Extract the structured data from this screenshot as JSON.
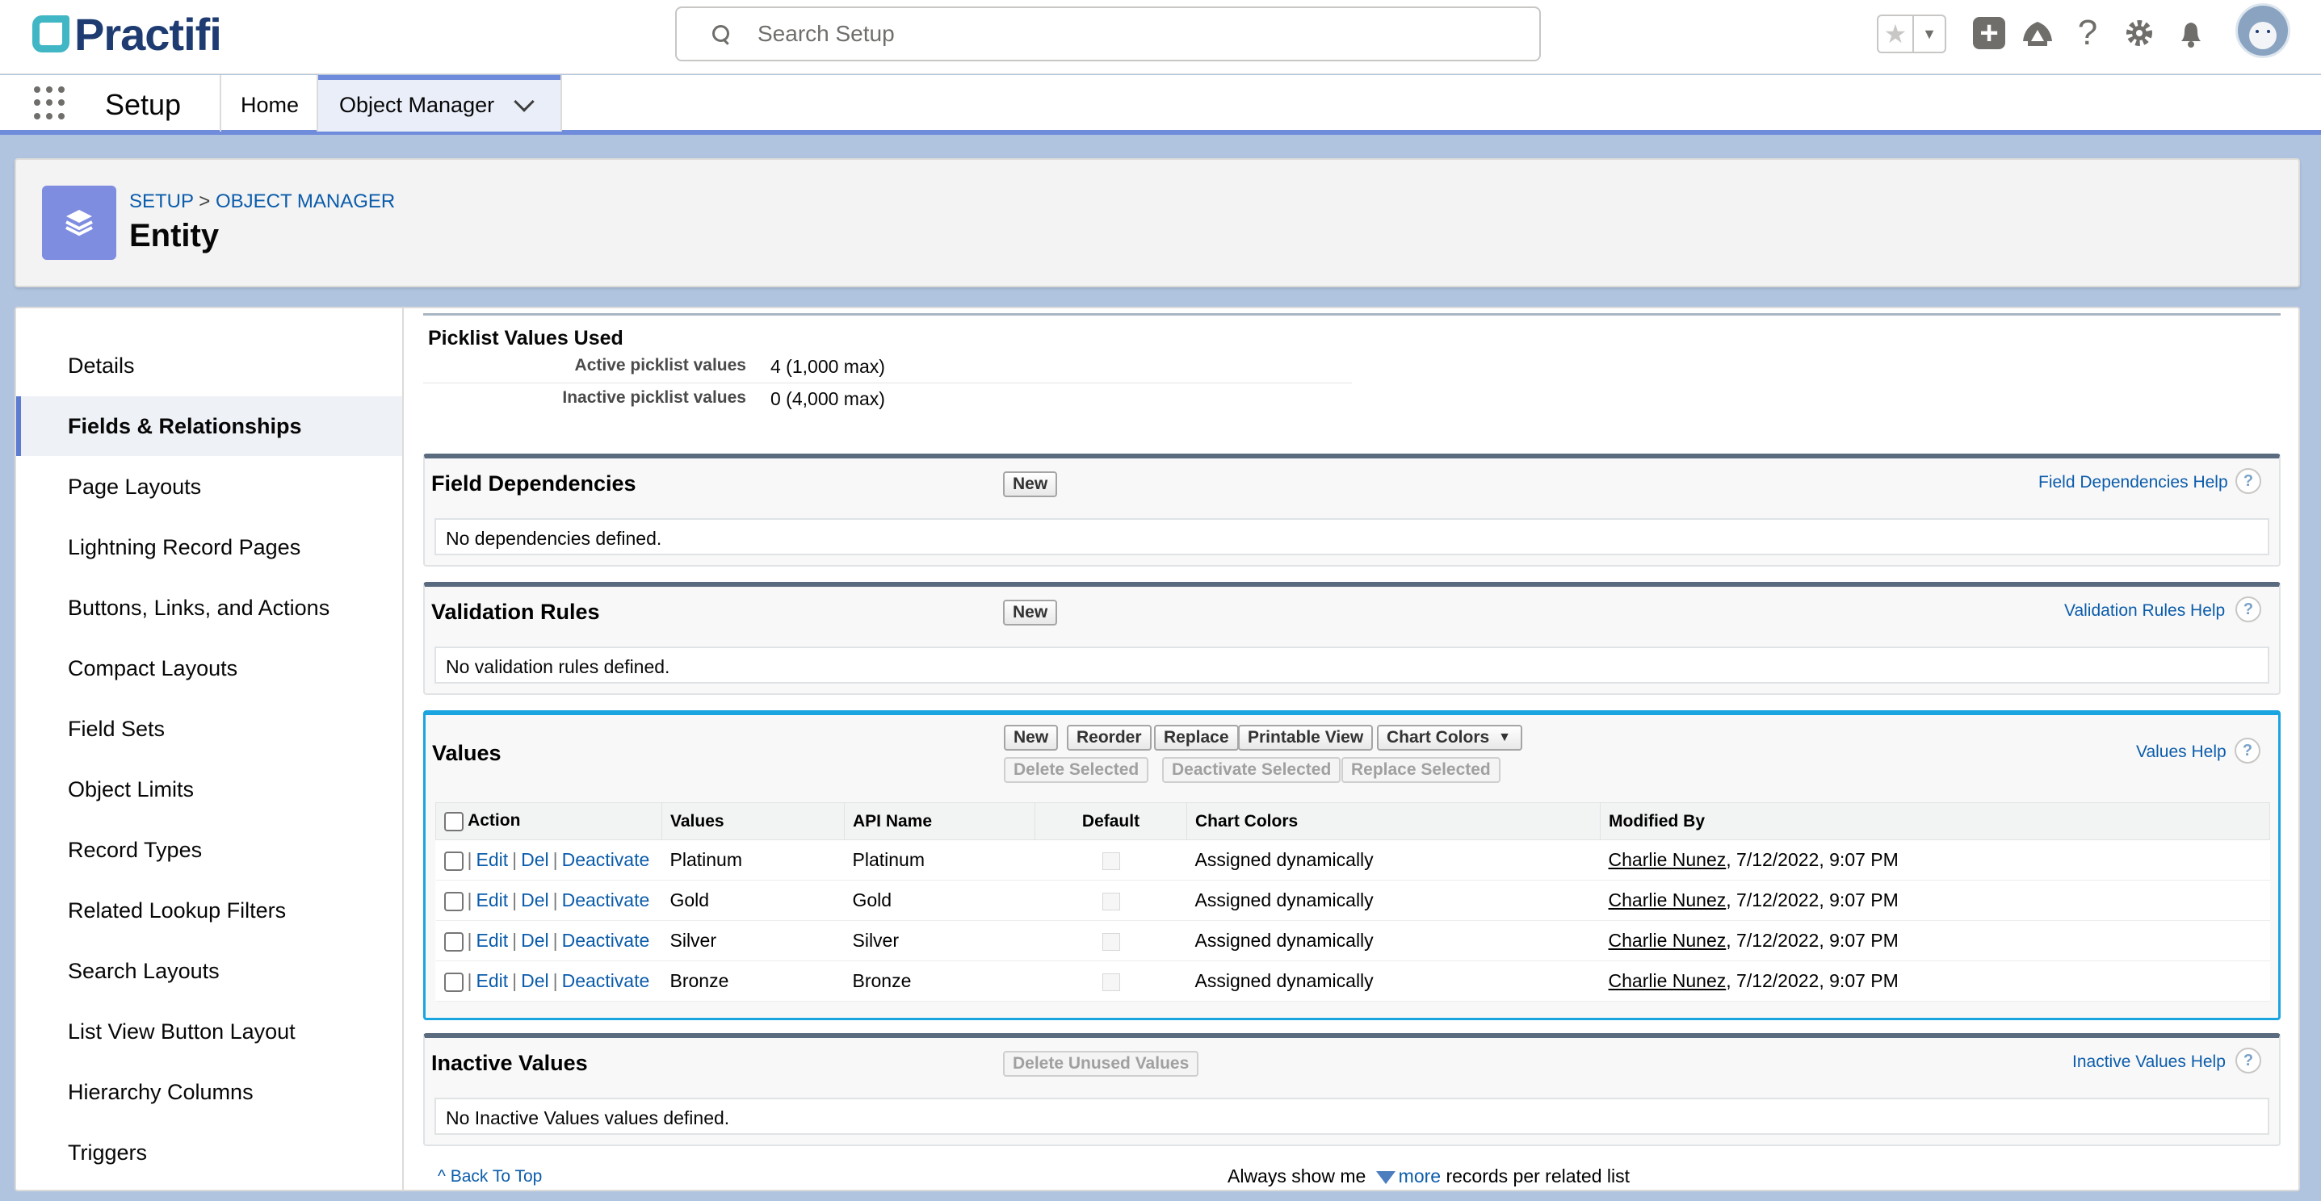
{
  "header": {
    "brand": "Practifi",
    "search_placeholder": "Search Setup"
  },
  "nav": {
    "app_name": "Setup",
    "tabs": [
      {
        "label": "Home"
      },
      {
        "label": "Object Manager"
      }
    ]
  },
  "page": {
    "breadcrumb_root": "SETUP",
    "breadcrumb_sep": ">",
    "breadcrumb_current": "OBJECT MANAGER",
    "title": "Entity"
  },
  "sidebar": {
    "items": [
      {
        "label": "Details"
      },
      {
        "label": "Fields & Relationships"
      },
      {
        "label": "Page Layouts"
      },
      {
        "label": "Lightning Record Pages"
      },
      {
        "label": "Buttons, Links, and Actions"
      },
      {
        "label": "Compact Layouts"
      },
      {
        "label": "Field Sets"
      },
      {
        "label": "Object Limits"
      },
      {
        "label": "Record Types"
      },
      {
        "label": "Related Lookup Filters"
      },
      {
        "label": "Search Layouts"
      },
      {
        "label": "List View Button Layout"
      },
      {
        "label": "Hierarchy Columns"
      },
      {
        "label": "Triggers"
      }
    ]
  },
  "picklist_used": {
    "title": "Picklist Values Used",
    "active_label": "Active picklist values",
    "active_value": "4 (1,000 max)",
    "inactive_label": "Inactive picklist values",
    "inactive_value": "0 (4,000 max)"
  },
  "field_dependencies": {
    "title": "Field Dependencies",
    "new_label": "New",
    "help": "Field Dependencies Help",
    "empty": "No dependencies defined."
  },
  "validation_rules": {
    "title": "Validation Rules",
    "new_label": "New",
    "help": "Validation Rules Help",
    "empty": "No validation rules defined."
  },
  "values": {
    "title": "Values",
    "buttons": {
      "new": "New",
      "reorder": "Reorder",
      "replace": "Replace",
      "printable": "Printable View",
      "chart_colors": "Chart Colors",
      "delete_selected": "Delete Selected",
      "deactivate_selected": "Deactivate Selected",
      "replace_selected": "Replace Selected"
    },
    "help": "Values Help",
    "columns": [
      "Action",
      "Values",
      "API Name",
      "Default",
      "Chart Colors",
      "Modified By"
    ],
    "action_links": {
      "edit": "Edit",
      "del": "Del",
      "deactivate": "Deactivate",
      "sep": "|"
    },
    "rows": [
      {
        "value": "Platinum",
        "api": "Platinum",
        "color": "Assigned dynamically",
        "user": "Charlie Nunez",
        "date": ", 7/12/2022, 9:07 PM"
      },
      {
        "value": "Gold",
        "api": "Gold",
        "color": "Assigned dynamically",
        "user": "Charlie Nunez",
        "date": ", 7/12/2022, 9:07 PM"
      },
      {
        "value": "Silver",
        "api": "Silver",
        "color": "Assigned dynamically",
        "user": "Charlie Nunez",
        "date": ", 7/12/2022, 9:07 PM"
      },
      {
        "value": "Bronze",
        "api": "Bronze",
        "color": "Assigned dynamically",
        "user": "Charlie Nunez",
        "date": ", 7/12/2022, 9:07 PM"
      }
    ]
  },
  "inactive_values": {
    "title": "Inactive Values",
    "delete_unused": "Delete Unused Values",
    "help": "Inactive Values Help",
    "empty": "No Inactive Values values defined."
  },
  "footer": {
    "back_to_top": "Back To Top",
    "always_show": "Always show me",
    "more": "more",
    "suffix": "records per related list"
  },
  "colors": {
    "link": "#0b5cab",
    "accent": "#6f8bdc",
    "selected_border": "#1ba5e0",
    "brand_teal": "#41b6c4",
    "brand_navy": "#1e3c72"
  }
}
